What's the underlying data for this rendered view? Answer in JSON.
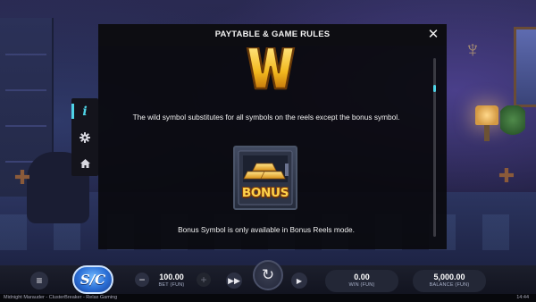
{
  "modal": {
    "title": "PAYTABLE & GAME RULES",
    "close_icon": "close-icon",
    "wild_description": "The wild symbol substitutes for all symbols on the reels except the bonus symbol.",
    "bonus_label": "BONUS",
    "bonus_description": "Bonus Symbol is only available in Bonus Reels mode.",
    "wild_letter": "W"
  },
  "side_menu": {
    "items": [
      {
        "icon": "info-icon",
        "glyph": "i",
        "active": true
      },
      {
        "icon": "gear-icon",
        "glyph": "⚙",
        "active": false
      },
      {
        "icon": "home-icon",
        "glyph": "⌂",
        "active": false
      }
    ]
  },
  "bottom_bar": {
    "menu_icon": "≡",
    "sc_badge": "S/C",
    "bet": {
      "value": "100.00",
      "label": "BET (FUN)"
    },
    "win": {
      "value": "0.00",
      "label": "WIN (FUN)"
    },
    "balance": {
      "value": "5,000.00",
      "label": "BALANCE (FUN)"
    },
    "minus": "−",
    "plus": "+",
    "turbo": "▶▶",
    "spin": "↻",
    "autoplay": "▶"
  },
  "status": {
    "left": "Midnight Marauder - ClusterBreaker - Relax Gaming",
    "time": "14:44"
  },
  "colors": {
    "accent": "#4fd3e6",
    "bonus_gold": "#ffd24a",
    "wild_gold": "#f2b81e"
  }
}
